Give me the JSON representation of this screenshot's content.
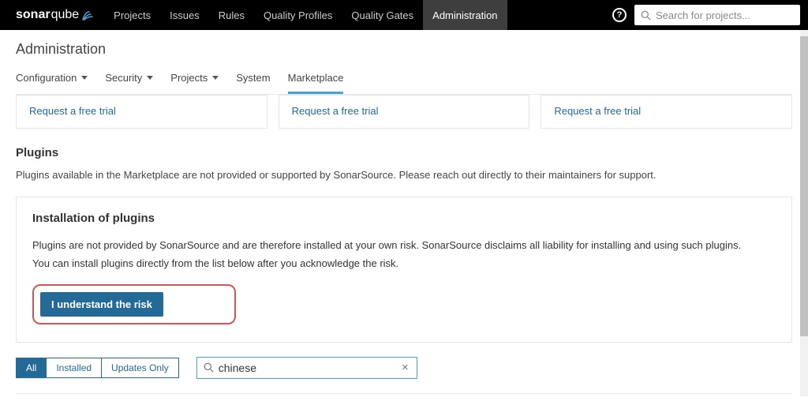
{
  "brand": {
    "name1": "sonar",
    "name2": "qube"
  },
  "nav": {
    "projects": "Projects",
    "issues": "Issues",
    "rules": "Rules",
    "quality_profiles": "Quality Profiles",
    "quality_gates": "Quality Gates",
    "administration": "Administration"
  },
  "search": {
    "placeholder": "Search for projects..."
  },
  "page_title": "Administration",
  "subnav": {
    "configuration": "Configuration",
    "security": "Security",
    "projects": "Projects",
    "system": "System",
    "marketplace": "Marketplace"
  },
  "trial_link": "Request a free trial",
  "plugins": {
    "title": "Plugins",
    "desc": "Plugins available in the Marketplace are not provided or supported by SonarSource. Please reach out directly to their maintainers for support."
  },
  "install": {
    "title": "Installation of plugins",
    "line1": "Plugins are not provided by SonarSource and are therefore installed at your own risk. SonarSource disclaims all liability for installing and using such plugins.",
    "line2": "You can install plugins directly from the list below after you acknowledge the risk.",
    "button": "I understand the risk"
  },
  "filters": {
    "all": "All",
    "installed": "Installed",
    "updates": "Updates Only"
  },
  "plugin_search_value": "chinese"
}
